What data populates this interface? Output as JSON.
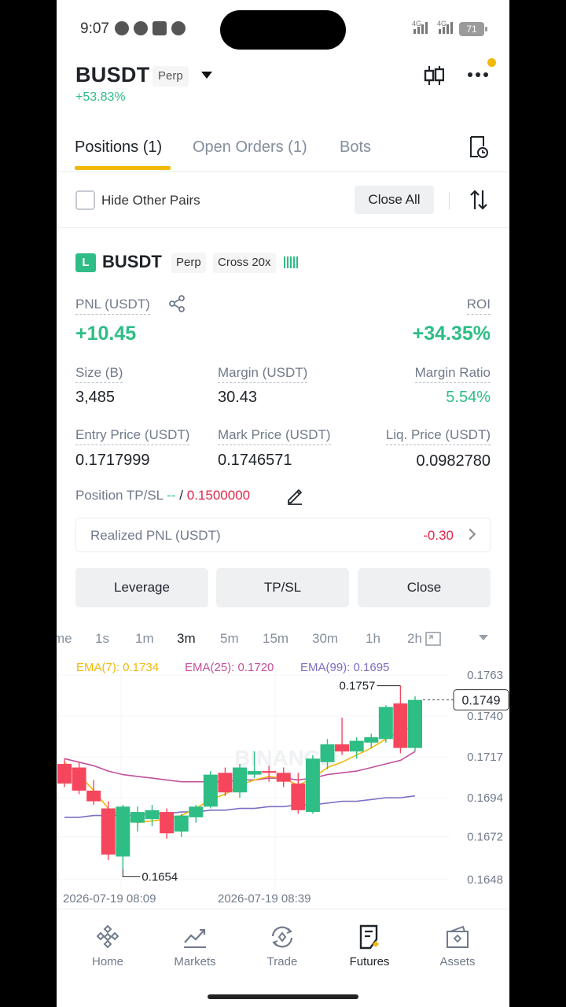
{
  "status": {
    "time": "9:07",
    "net1": "4G",
    "net2": "4G",
    "battery": "71"
  },
  "header": {
    "symbol": "BUSDT",
    "type_tag": "Perp",
    "change": "+53.83%"
  },
  "tabs": [
    {
      "label": "Positions (1)"
    },
    {
      "label": "Open Orders (1)"
    },
    {
      "label": "Bots"
    }
  ],
  "controls": {
    "hide_other_pairs": "Hide Other Pairs",
    "close_all": "Close All"
  },
  "position": {
    "side_badge": "L",
    "symbol": "BUSDT",
    "type_tag": "Perp",
    "margin_tag": "Cross 20x",
    "pnl_label": "PNL (USDT)",
    "pnl_value": "+10.45",
    "roi_label": "ROI",
    "roi_value": "+34.35%",
    "size_label": "Size (B)",
    "size_value": "3,485",
    "margin_label": "Margin (USDT)",
    "margin_value": "30.43",
    "margin_ratio_label": "Margin Ratio",
    "margin_ratio_value": "5.54%",
    "entry_label": "Entry Price (USDT)",
    "entry_value": "0.1717999",
    "mark_label": "Mark Price (USDT)",
    "mark_value": "0.1746571",
    "liq_label": "Liq. Price (USDT)",
    "liq_value": "0.0982780",
    "tpsl_label": "Position TP/SL",
    "tp_value": "--",
    "tpsl_sep": " / ",
    "sl_value": "0.1500000",
    "realized_label": "Realized PNL (USDT)",
    "realized_value": "-0.30"
  },
  "actions": {
    "leverage": "Leverage",
    "tpsl": "TP/SL",
    "close": "Close"
  },
  "intervals": [
    {
      "label": "me"
    },
    {
      "label": "1s"
    },
    {
      "label": "1m"
    },
    {
      "label": "3m"
    },
    {
      "label": "5m"
    },
    {
      "label": "15m"
    },
    {
      "label": "30m"
    },
    {
      "label": "1h"
    },
    {
      "label": "2h"
    }
  ],
  "chart_data": {
    "type": "candlestick",
    "indicators": [
      {
        "label": "EMA(7): 0.1734",
        "color": "#f0b90b"
      },
      {
        "label": "EMA(25): 0.1720",
        "color": "#c2509c"
      },
      {
        "label": "EMA(99): 0.1695",
        "color": "#7a6fc4"
      }
    ],
    "y_ticks": [
      "0.1763",
      "0.1740",
      "0.1717",
      "0.1694",
      "0.1672",
      "0.1648"
    ],
    "current_price": "0.1749",
    "high_label": "0.1757",
    "low_label": "0.1654",
    "x_ticks": [
      "2026-07-19 08:09",
      "2026-07-19 08:39"
    ],
    "watermark": "BINANCE",
    "candles": [
      {
        "o": 0.1713,
        "h": 0.1716,
        "l": 0.17,
        "c": 0.1702
      },
      {
        "o": 0.1711,
        "h": 0.1714,
        "l": 0.1696,
        "c": 0.1698
      },
      {
        "o": 0.1698,
        "h": 0.1704,
        "l": 0.169,
        "c": 0.1692
      },
      {
        "o": 0.1688,
        "h": 0.1692,
        "l": 0.1659,
        "c": 0.1662
      },
      {
        "o": 0.1661,
        "h": 0.169,
        "l": 0.1654,
        "c": 0.1689
      },
      {
        "o": 0.168,
        "h": 0.1689,
        "l": 0.1675,
        "c": 0.1686
      },
      {
        "o": 0.1682,
        "h": 0.169,
        "l": 0.1678,
        "c": 0.1687
      },
      {
        "o": 0.1686,
        "h": 0.1688,
        "l": 0.1671,
        "c": 0.1674
      },
      {
        "o": 0.1675,
        "h": 0.1685,
        "l": 0.1672,
        "c": 0.1684
      },
      {
        "o": 0.1683,
        "h": 0.169,
        "l": 0.168,
        "c": 0.1689
      },
      {
        "o": 0.1689,
        "h": 0.1709,
        "l": 0.1688,
        "c": 0.1707
      },
      {
        "o": 0.1708,
        "h": 0.1711,
        "l": 0.1695,
        "c": 0.1697
      },
      {
        "o": 0.1697,
        "h": 0.1713,
        "l": 0.1694,
        "c": 0.1711
      },
      {
        "o": 0.1707,
        "h": 0.172,
        "l": 0.1705,
        "c": 0.1709
      },
      {
        "o": 0.1709,
        "h": 0.1712,
        "l": 0.1703,
        "c": 0.1708
      },
      {
        "o": 0.1708,
        "h": 0.1711,
        "l": 0.17,
        "c": 0.1703
      },
      {
        "o": 0.1702,
        "h": 0.1708,
        "l": 0.1685,
        "c": 0.1687
      },
      {
        "o": 0.1686,
        "h": 0.1718,
        "l": 0.1685,
        "c": 0.1716
      },
      {
        "o": 0.1714,
        "h": 0.1727,
        "l": 0.171,
        "c": 0.1724
      },
      {
        "o": 0.1724,
        "h": 0.1739,
        "l": 0.1718,
        "c": 0.172
      },
      {
        "o": 0.172,
        "h": 0.1728,
        "l": 0.1716,
        "c": 0.1726
      },
      {
        "o": 0.1725,
        "h": 0.173,
        "l": 0.1722,
        "c": 0.1728
      },
      {
        "o": 0.1727,
        "h": 0.1746,
        "l": 0.1725,
        "c": 0.1745
      },
      {
        "o": 0.1747,
        "h": 0.1757,
        "l": 0.1719,
        "c": 0.1722
      },
      {
        "o": 0.1722,
        "h": 0.1751,
        "l": 0.172,
        "c": 0.1749
      }
    ],
    "ema7": [
      0.1714,
      0.1707,
      0.1698,
      0.1688,
      0.1683,
      0.168,
      0.1681,
      0.1682,
      0.1684,
      0.1688,
      0.1693,
      0.1696,
      0.1701,
      0.1704,
      0.1706,
      0.1705,
      0.1701,
      0.1705,
      0.1711,
      0.1714,
      0.1718,
      0.1722,
      0.1727,
      0.1732,
      0.1734
    ],
    "ema25": [
      0.1716,
      0.1714,
      0.1712,
      0.1709,
      0.1707,
      0.1706,
      0.1705,
      0.1704,
      0.1703,
      0.1703,
      0.1703,
      0.1703,
      0.1704,
      0.1704,
      0.1705,
      0.1705,
      0.1704,
      0.1705,
      0.1707,
      0.1708,
      0.1709,
      0.1711,
      0.1713,
      0.1715,
      0.172
    ],
    "ema99": [
      0.1683,
      0.1683,
      0.1684,
      0.1684,
      0.1684,
      0.1684,
      0.1685,
      0.1685,
      0.1686,
      0.1686,
      0.1687,
      0.1687,
      0.1688,
      0.1688,
      0.1689,
      0.1689,
      0.169,
      0.169,
      0.1691,
      0.1692,
      0.1692,
      0.1693,
      0.1694,
      0.1694,
      0.1695
    ],
    "colors": {
      "up": "#2ebd85",
      "down": "#f6465d"
    }
  },
  "nav": [
    {
      "label": "Home",
      "icon": "home-icon"
    },
    {
      "label": "Markets",
      "icon": "markets-icon"
    },
    {
      "label": "Trade",
      "icon": "trade-icon"
    },
    {
      "label": "Futures",
      "icon": "futures-icon"
    },
    {
      "label": "Assets",
      "icon": "assets-icon"
    }
  ]
}
